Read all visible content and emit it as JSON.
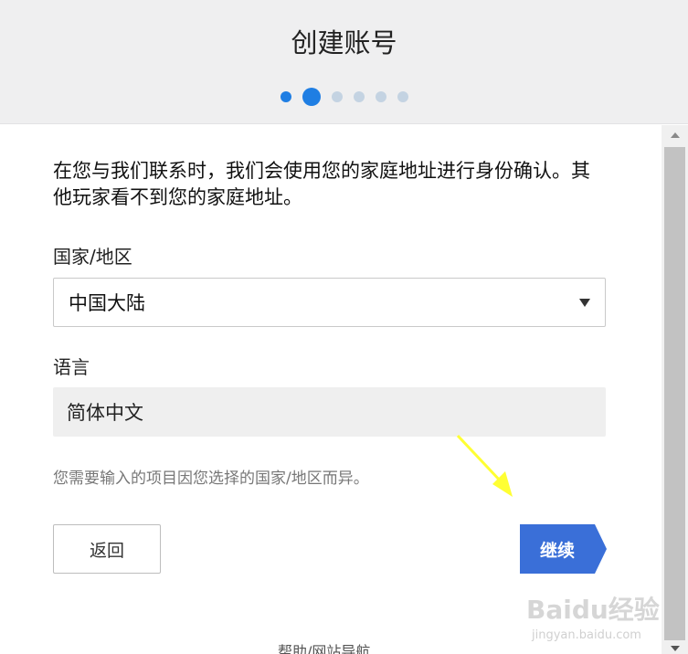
{
  "header": {
    "title": "创建账号",
    "steps": {
      "total": 6,
      "current": 2
    }
  },
  "intro_text": "在您与我们联系时，我们会使用您的家庭地址进行身份确认。其他玩家看不到您的家庭地址。",
  "country": {
    "label": "国家/地区",
    "selected": "中国大陆"
  },
  "language": {
    "label": "语言",
    "value": "简体中文"
  },
  "note": "您需要输入的项目因您选择的国家/地区而异。",
  "buttons": {
    "back_label": "返回",
    "next_label": "继续"
  },
  "footer": {
    "help_link": "帮助/网站导航"
  },
  "watermark": {
    "main": "Baidu经验",
    "sub": "jingyan.baidu.com"
  },
  "colors": {
    "accent": "#1f7ee3",
    "next_button": "#3a6fd8",
    "annotation_arrow": "#ffff33"
  }
}
